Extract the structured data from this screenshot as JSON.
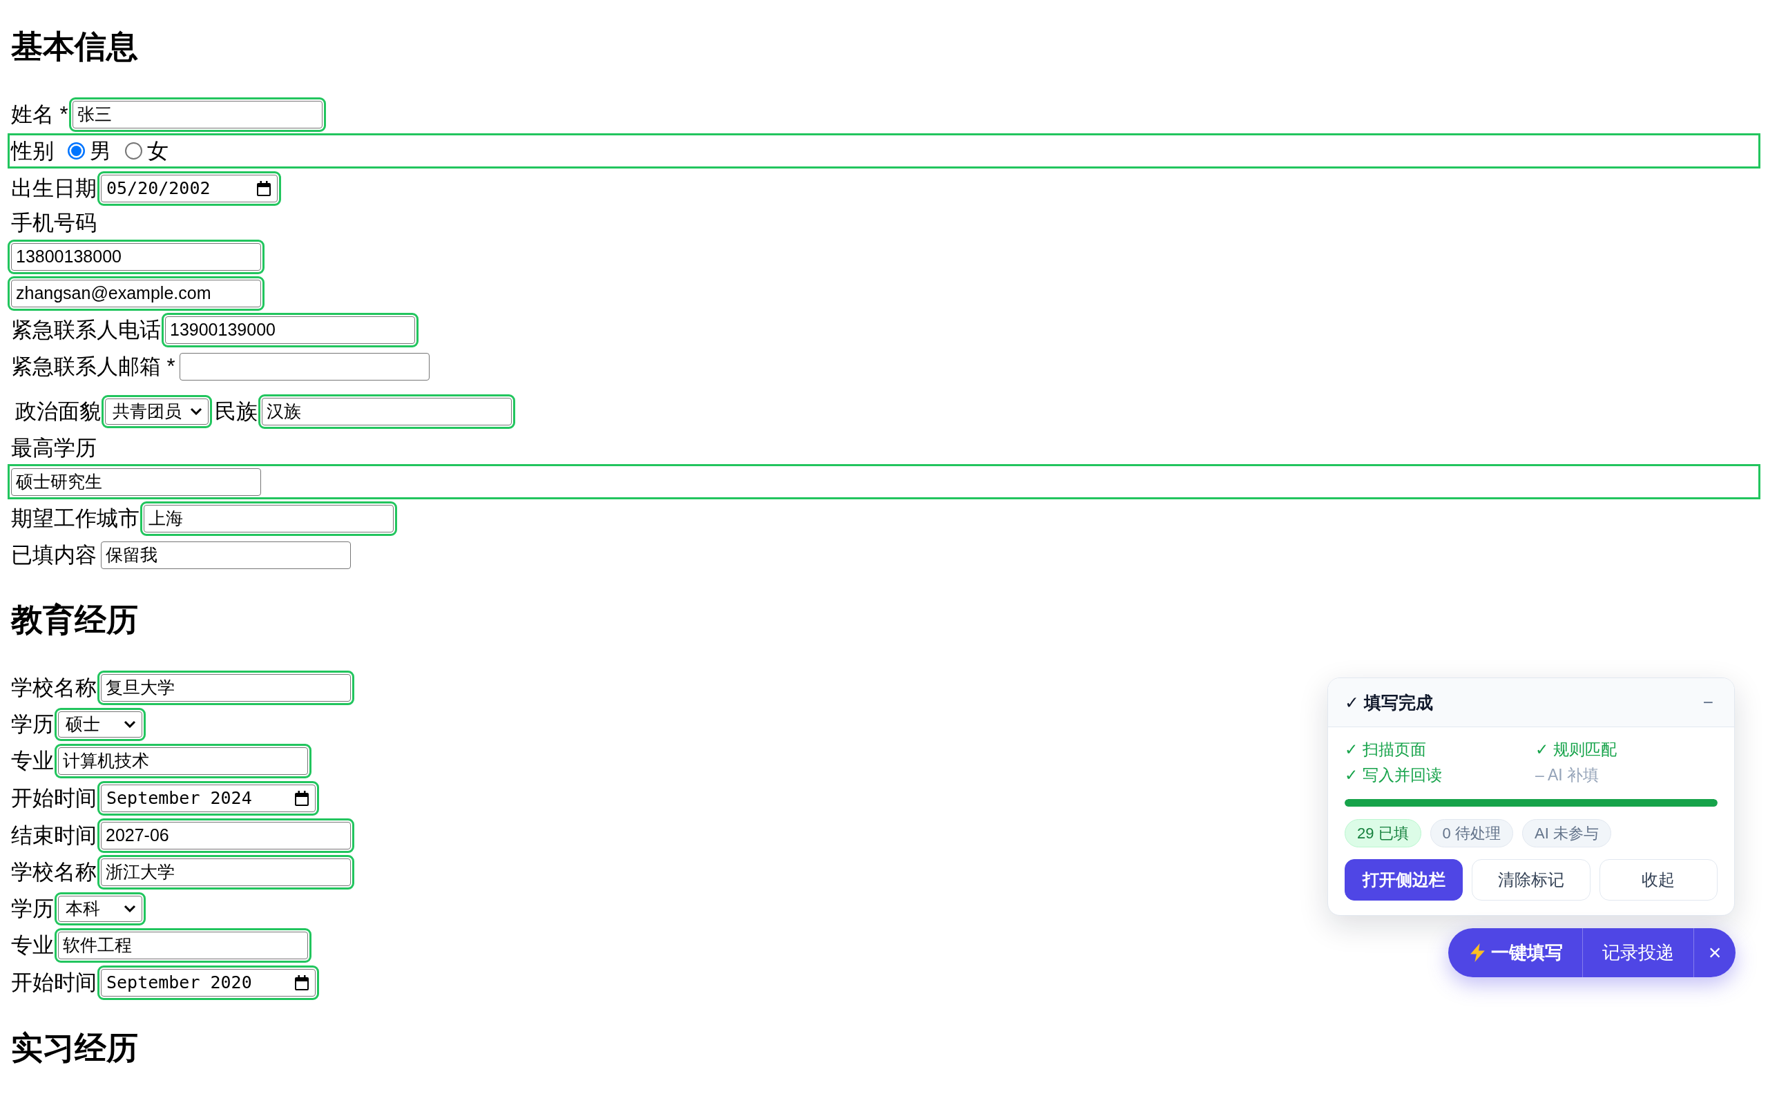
{
  "sections": [
    {
      "title": "基本信息",
      "lines": [
        {
          "marked": false,
          "items": [
            {
              "kind": "label",
              "text": "姓名 *"
            },
            {
              "kind": "text",
              "value": "张三",
              "marked": true
            }
          ]
        },
        {
          "marked": true,
          "items": [
            {
              "kind": "label",
              "text": "性别"
            },
            {
              "kind": "radio",
              "label": "男",
              "selected": true
            },
            {
              "kind": "radio",
              "label": "女",
              "selected": false
            }
          ]
        },
        {
          "marked": false,
          "items": [
            {
              "kind": "label",
              "text": "出生日期"
            },
            {
              "kind": "date",
              "value": "05/20/2002",
              "marked": true
            }
          ]
        },
        {
          "marked": false,
          "items": [
            {
              "kind": "label",
              "text": "手机号码"
            }
          ]
        },
        {
          "marked": false,
          "items": [
            {
              "kind": "text",
              "value": "13800138000",
              "marked": true
            }
          ]
        },
        {
          "marked": false,
          "items": [
            {
              "kind": "text",
              "value": "zhangsan@example.com",
              "marked": true
            }
          ]
        },
        {
          "marked": false,
          "items": [
            {
              "kind": "label",
              "text": "紧急联系人电话"
            },
            {
              "kind": "text",
              "value": "13900139000",
              "marked": true
            }
          ]
        },
        {
          "marked": false,
          "items": [
            {
              "kind": "label",
              "text": "紧急联系人邮箱 *"
            },
            {
              "kind": "text",
              "marked": false
            }
          ]
        },
        {
          "marked": false,
          "items": [
            {
              "kind": "label",
              "text": "政治面貌"
            },
            {
              "kind": "select",
              "value": "共青团员",
              "marked": true
            },
            {
              "kind": "label",
              "text": "民族"
            },
            {
              "kind": "text",
              "value": "汉族",
              "marked": true
            }
          ]
        },
        {
          "marked": false,
          "items": [
            {
              "kind": "label",
              "text": "最高学历"
            }
          ]
        },
        {
          "marked": true,
          "items": [
            {
              "kind": "text",
              "value": "硕士研究生",
              "marked": false
            }
          ]
        },
        {
          "marked": false,
          "items": [
            {
              "kind": "label",
              "text": "期望工作城市"
            },
            {
              "kind": "text",
              "value": "上海",
              "marked": true
            }
          ]
        },
        {
          "marked": false,
          "items": [
            {
              "kind": "label",
              "text": "已填内容"
            },
            {
              "kind": "text",
              "value": "保留我",
              "marked": false
            }
          ]
        }
      ]
    },
    {
      "title": "教育经历",
      "lines": [
        {
          "marked": false,
          "items": [
            {
              "kind": "label",
              "text": "学校名称"
            },
            {
              "kind": "text",
              "value": "复旦大学",
              "marked": true
            }
          ]
        },
        {
          "marked": false,
          "items": [
            {
              "kind": "label",
              "text": "学历"
            },
            {
              "kind": "select",
              "value": "硕士",
              "marked": true
            }
          ]
        },
        {
          "marked": false,
          "items": [
            {
              "kind": "label",
              "text": "专业"
            },
            {
              "kind": "text",
              "value": "计算机技术",
              "marked": true
            }
          ]
        },
        {
          "marked": false,
          "items": [
            {
              "kind": "label",
              "text": "开始时间"
            },
            {
              "kind": "month",
              "value": "September 2024",
              "marked": true
            }
          ]
        },
        {
          "marked": false,
          "items": [
            {
              "kind": "label",
              "text": "结束时间"
            },
            {
              "kind": "text",
              "value": "2027-06",
              "marked": true
            }
          ]
        },
        {
          "marked": false,
          "items": [
            {
              "kind": "label",
              "text": "学校名称"
            },
            {
              "kind": "text",
              "value": "浙江大学",
              "marked": true
            }
          ]
        },
        {
          "marked": false,
          "items": [
            {
              "kind": "label",
              "text": "学历"
            },
            {
              "kind": "select",
              "value": "本科",
              "marked": true
            }
          ]
        },
        {
          "marked": false,
          "items": [
            {
              "kind": "label",
              "text": "专业"
            },
            {
              "kind": "text",
              "value": "软件工程",
              "marked": true
            }
          ]
        },
        {
          "marked": false,
          "items": [
            {
              "kind": "label",
              "text": "开始时间"
            },
            {
              "kind": "month",
              "value": "September 2020",
              "marked": true
            }
          ]
        }
      ]
    },
    {
      "title": "实习经历"
    }
  ],
  "autofill_panel": {
    "title": "✓ 填写完成",
    "minimize": "−",
    "steps": [
      {
        "label": "✓ 扫描页面",
        "done": true
      },
      {
        "label": "✓ 规则匹配",
        "done": true
      },
      {
        "label": "✓ 写入并回读",
        "done": true
      },
      {
        "label": "– AI 补填",
        "done": false
      }
    ],
    "progress": {
      "level": 1.0
    },
    "stats": [
      {
        "label": "29 已填",
        "kind": "success"
      },
      {
        "label": "0 待处理",
        "kind": "neutral"
      },
      {
        "label": "AI 未参与",
        "kind": "neutral"
      }
    ],
    "buttons": [
      {
        "label": "打开侧边栏",
        "primary": true
      },
      {
        "label": "清除标记",
        "primary": false
      },
      {
        "label": "收起",
        "primary": false
      }
    ]
  },
  "action_bar": {
    "buttons": [
      {
        "label": "一键填写",
        "kind": "fill"
      },
      {
        "label": "记录投递",
        "kind": "record"
      },
      {
        "label": "×",
        "kind": "close"
      }
    ]
  }
}
